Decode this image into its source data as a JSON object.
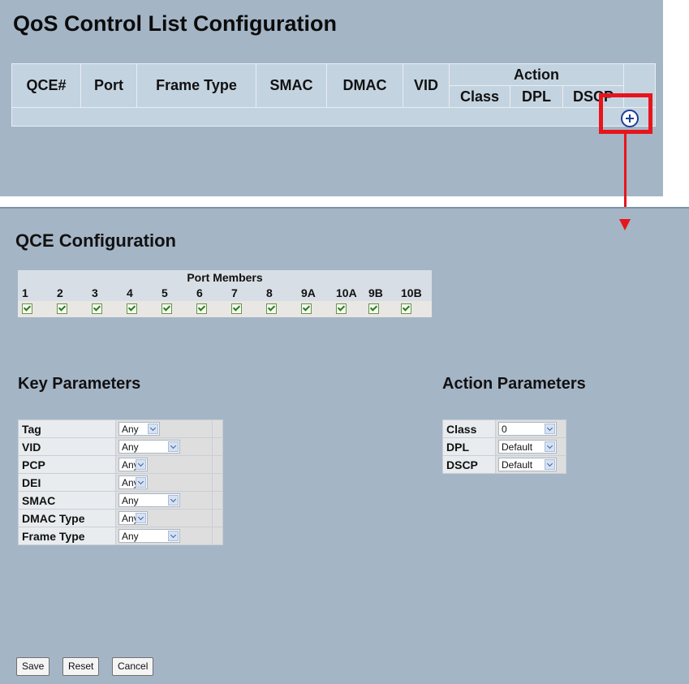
{
  "qcl": {
    "title": "QoS Control List Configuration",
    "headers": [
      "QCE#",
      "Port",
      "Frame Type",
      "SMAC",
      "DMAC",
      "VID"
    ],
    "action_header": "Action",
    "action_sub": [
      "Class",
      "DPL",
      "DSCP"
    ]
  },
  "qce": {
    "title": "QCE Configuration",
    "port_members_header": "Port Members",
    "ports": [
      "1",
      "2",
      "3",
      "4",
      "5",
      "6",
      "7",
      "8",
      "9A",
      "10A",
      "9B",
      "10B"
    ],
    "port_checked": [
      true,
      true,
      true,
      true,
      true,
      true,
      true,
      true,
      true,
      true,
      true,
      true
    ]
  },
  "key_params": {
    "title": "Key Parameters",
    "rows": [
      {
        "label": "Tag",
        "value": "Any"
      },
      {
        "label": "VID",
        "value": "Any"
      },
      {
        "label": "PCP",
        "value": "Any"
      },
      {
        "label": "DEI",
        "value": "Any"
      },
      {
        "label": "SMAC",
        "value": "Any"
      },
      {
        "label": "DMAC Type",
        "value": "Any"
      },
      {
        "label": "Frame Type",
        "value": "Any"
      }
    ]
  },
  "action_params": {
    "title": "Action Parameters",
    "rows": [
      {
        "label": "Class",
        "value": "0"
      },
      {
        "label": "DPL",
        "value": "Default"
      },
      {
        "label": "DSCP",
        "value": "Default"
      }
    ]
  },
  "buttons": {
    "save": "Save",
    "reset": "Reset",
    "cancel": "Cancel"
  },
  "colors": {
    "panel": "#a4b5c6",
    "highlight": "#e8141b",
    "add_icon": "#1e3f9a"
  },
  "icons": {
    "add": "plus-circle-icon",
    "dropdown": "chevron-down-icon",
    "checkbox": "checkmark-icon"
  }
}
